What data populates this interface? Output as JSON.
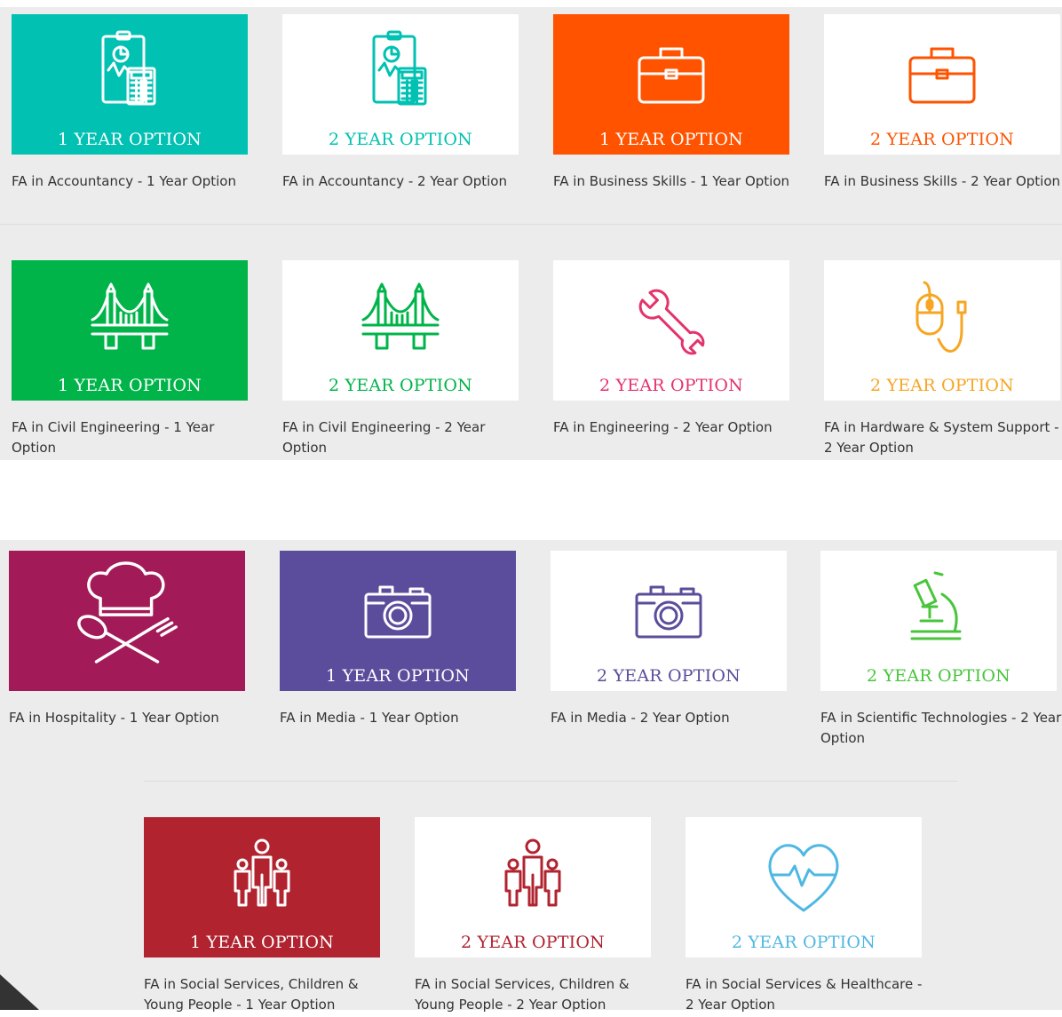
{
  "colors": {
    "teal": "#00c1b2",
    "orange": "#ff5300",
    "green": "#00b44a",
    "pink": "#e4336c",
    "gold": "#f6a623",
    "magenta": "#a21a58",
    "purple": "#5b4d9b",
    "lime": "#48c53b",
    "crimson": "#b0232f",
    "sky": "#4fb8e2",
    "page_bg": "#ececec"
  },
  "cards": [
    {
      "option": "1 YEAR OPTION",
      "title": "FA in Accountancy - 1 Year Option",
      "icon": "accounting-calculator-icon",
      "style": "filled",
      "color": "#00c1b2"
    },
    {
      "option": "2 YEAR OPTION",
      "title": "FA in Accountancy - 2 Year Option",
      "icon": "accounting-calculator-icon",
      "style": "outline",
      "color": "#00c1b2"
    },
    {
      "option": "1 YEAR OPTION",
      "title": "FA in Business Skills - 1 Year Option",
      "icon": "briefcase-icon",
      "style": "filled",
      "color": "#ff5300"
    },
    {
      "option": "2 YEAR OPTION",
      "title": "FA in Business Skills - 2 Year Option",
      "icon": "briefcase-icon",
      "style": "outline",
      "color": "#ff5300"
    },
    {
      "option": "1 YEAR OPTION",
      "title": "FA in Civil Engineering - 1 Year Option",
      "icon": "bridge-icon",
      "style": "filled",
      "color": "#00b44a"
    },
    {
      "option": "2 YEAR OPTION",
      "title": "FA in Civil Engineering - 2 Year Option",
      "icon": "bridge-icon",
      "style": "outline",
      "color": "#00b44a"
    },
    {
      "option": "2 YEAR OPTION",
      "title": "FA in Engineering - 2 Year Option",
      "icon": "wrench-icon",
      "style": "outline",
      "color": "#e4336c"
    },
    {
      "option": "2 YEAR OPTION",
      "title": "FA in Hardware & System Support - 2 Year Option",
      "icon": "computer-mouse-icon",
      "style": "outline",
      "color": "#f6a623"
    },
    {
      "option": "",
      "title": "FA in Hospitality - 1 Year Option",
      "icon": "chef-hat-cutlery-icon",
      "style": "filled",
      "color": "#a21a58"
    },
    {
      "option": "1 YEAR OPTION",
      "title": "FA in Media - 1 Year Option",
      "icon": "camera-icon",
      "style": "filled",
      "color": "#5b4d9b"
    },
    {
      "option": "2 YEAR OPTION",
      "title": "FA in Media - 2 Year Option",
      "icon": "camera-icon",
      "style": "outline",
      "color": "#5b4d9b"
    },
    {
      "option": "2 YEAR OPTION",
      "title": "FA in Scientific Technologies - 2 Year Option",
      "icon": "microscope-icon",
      "style": "outline",
      "color": "#48c53b"
    },
    {
      "option": "1 YEAR OPTION",
      "title": "FA in Social Services, Children & Young People - 1 Year Option",
      "icon": "family-icon",
      "style": "filled",
      "color": "#b0232f"
    },
    {
      "option": "2 YEAR OPTION",
      "title": "FA in Social Services, Children & Young People - 2 Year Option",
      "icon": "family-icon",
      "style": "outline",
      "color": "#b0232f"
    },
    {
      "option": "2 YEAR OPTION",
      "title": "FA in Social Services & Healthcare - 2 Year Option",
      "icon": "heartbeat-icon",
      "style": "outline",
      "color": "#4fb8e2"
    }
  ]
}
